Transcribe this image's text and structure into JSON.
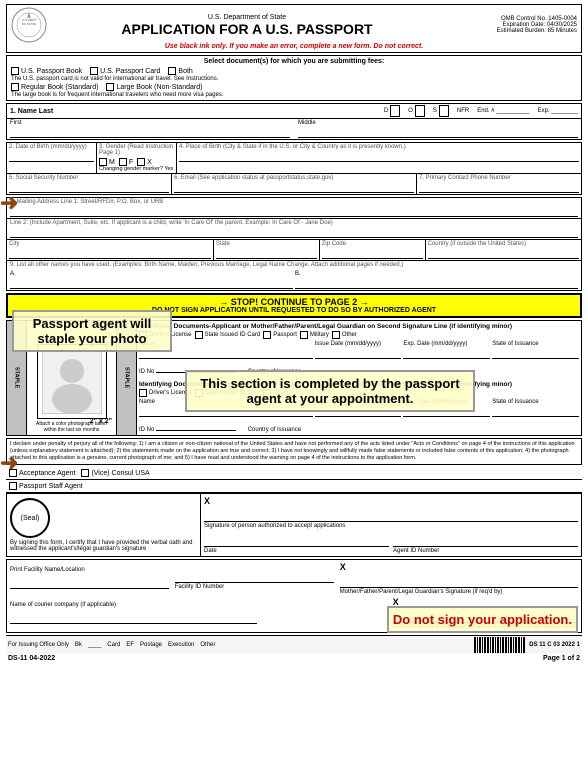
{
  "header": {
    "department": "U.S. Department of State",
    "title": "APPLICATION FOR A U.S. PASSPORT",
    "instruction": "Use black ink only. If you make an error, complete a new form. Do not correct.",
    "omb_control": "OMB Control No. 1405-0004",
    "expiration": "Expiration Date: 04/30/2025",
    "burden": "Estimated Burden: 85 Minutes"
  },
  "fees": {
    "title": "Select document(s) for which you are submitting fees:",
    "options": [
      "U.S. Passport Book",
      "U.S. Passport Card",
      "Both"
    ],
    "note": "The U.S. passport card is not valid for international air travel. See Instructions.",
    "book_types": [
      "Regular Book (Standard)",
      "Large Book (Non-Standard)"
    ],
    "large_book_note": "The large book is for frequent international travelers who need more visa pages."
  },
  "fields": {
    "name_label": "1. Name Last",
    "d_label": "D",
    "o_label": "O",
    "s_label": "S",
    "nfr_label": "NFR",
    "end_label": "End. #",
    "exp_label": "Exp.",
    "first_label": "First",
    "middle_label": "Middle",
    "dob_label": "2. Date of Birth (mm/dd/yyyy)",
    "gender_label": "3. Gender (Read Instruction Page 1)",
    "gender_options": "M  F  X",
    "gender_note": "Changing gender marker? Yes",
    "pob_label": "4. Place of Birth (City & State if in the U.S. or City & Country as it is presently known.)",
    "ssn_label": "5. Social Security Number",
    "email_label": "6. Email (See application status at passportstatus.state.gov)",
    "phone_label": "7. Primary Contact Phone Number",
    "address1_label": "8. Mailing Address Line 1: Street/RFD#, P.O. Box, or URB",
    "address2_label": "Line 2: (Include Apartment, Suite, etc. If applicant is a child, write 'In Care Of' the parent. Example: In Care Of - Jane Doe)",
    "city_label": "City",
    "state_label": "State",
    "zip_label": "Zip Code",
    "country_label": "Country (if outside the United States)",
    "other_names_label": "9. List all other names you have used. (Examples: Birth Name, Maiden, Previous Marriage, Legal Name Change. Attach additional pages if needed.)",
    "name_a_label": "A.",
    "name_b_label": "B."
  },
  "stop_section": {
    "title": "→ STOP! CONTINUE TO PAGE 2 →",
    "subtitle": "DO NOT SIGN APPLICATION UNTIL REQUESTED TO DO SO BY AUTHORIZED AGENT"
  },
  "id_section": {
    "title1": "Identifying Documents-Applicant or Mother/Father/Parent/Legal Guardian on Second Signature Line (if identifying minor)",
    "checkboxes": [
      "Driver's License",
      "State Issued ID Card",
      "Passport",
      "Military",
      "Other"
    ],
    "name_label": "Name",
    "issue_date_label": "Issue Date (mm/dd/yyyy)",
    "exp_date_label": "Exp. Date (mm/dd/yyyy)",
    "state_issuance_label": "State of Issuance",
    "id_no_label": "ID No",
    "title2": "Identifying Documents-Applicant or Mother/Father/Parent/Legal Guardian on Second Signature Line (if identifying minor)",
    "dl_label": "Driver's License",
    "state_id_label": "State Issued ID Card",
    "other_label": "Other"
  },
  "declaration": {
    "text": "I declare under penalty of perjury all of the following: 1) I am a citizen or non-citizen national of the United States and have not performed any of the acts listed under \"Acts or Conditions\" on page 4 of the instructions of this application (unless explanatory statement is attached); 2) the statements made on the application are true and correct; 3) I have not knowingly and willfully made false statements or included false contents of this application; 4) the photograph attached to this application is a genuine, current photograph of me; and 5) I have read and understood the warning on page 4 of the instructions to the application form."
  },
  "signature_area": {
    "x_label": "X",
    "sig_label": "Signature of person authorized to accept applications",
    "date_label": "Date",
    "agent_id_label": "Agent ID Number",
    "by_signing_label": "By signing this form, I certify that I have provided the verbal oath and witnessed the applicant's/legal guardian's signature",
    "mother_father_label": "Mother/Father/Parent/Legal Guardian's Signature (if req'd by)",
    "mother_father_minor_label": "Mother/Father/Parent/Legal Guardian's Signature (if identifying minor)",
    "seal_label": "(Seal)",
    "print_facility_label": "Print Facility Name/Location",
    "facility_id_label": "Facility ID Number",
    "courier_label": "Name of courier company (if applicable)"
  },
  "acceptance": {
    "agent_label": "Acceptance Agent",
    "consulate_label": "(Vice) Consul USA",
    "passport_staff_label": "Passport Staff Agent"
  },
  "bottom": {
    "for_issuing": "For Issuing Office Only",
    "bk_label": "Bk",
    "card_label": "Card",
    "ef_label": "EF",
    "postage_label": "Postage",
    "execution_label": "Execution",
    "other_label": "Other",
    "ds_number": "DS 11 C 03 2022 1",
    "form_number": "DS-11 04-2022",
    "page_label": "Page 1 of 2"
  },
  "overlays": {
    "passport_agent": "Passport agent will staple your photo",
    "this_section": "This section is completed by the passport agent at your appointment.",
    "do_not_sign": "Do not sign your application."
  },
  "photo": {
    "label": "2\" x 2\"",
    "note": "Attach a color photograph taken within the last six months"
  }
}
